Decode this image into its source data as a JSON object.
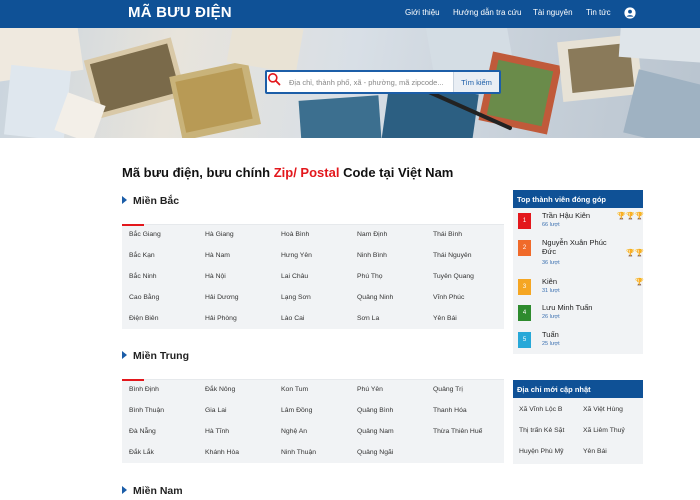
{
  "header": {
    "logo": "MÃ BƯU ĐIỆN",
    "nav": [
      "Giới thiệu",
      "Hướng dẫn tra cứu",
      "Tài nguyên",
      "Tin tức"
    ]
  },
  "search": {
    "placeholder": "Địa chỉ, thành phố, xã - phường, mã zipcode...",
    "button": "Tìm kiếm"
  },
  "title": {
    "part1": "Mã bưu điện, bưu chính ",
    "highlight": "Zip/ Postal",
    "part2": " Code tại Việt Nam"
  },
  "regions": [
    {
      "name": "Miền Bắc",
      "provinces": [
        "Bắc Giang",
        "Hà Giang",
        "Hoà Bình",
        "Nam Định",
        "Thái Bình",
        "Bắc Kạn",
        "Hà Nam",
        "Hưng Yên",
        "Ninh Bình",
        "Thái Nguyên",
        "Bắc Ninh",
        "Hà Nội",
        "Lai Châu",
        "Phú Thọ",
        "Tuyên Quang",
        "Cao Bằng",
        "Hải Dương",
        "Lạng Sơn",
        "Quảng Ninh",
        "Vĩnh Phúc",
        "Điện Biên",
        "Hải Phòng",
        "Lào Cai",
        "Sơn La",
        "Yên Bái"
      ]
    },
    {
      "name": "Miền Trung",
      "provinces": [
        "Bình Định",
        "Đắk Nông",
        "Kon Tum",
        "Phú Yên",
        "Quảng Trị",
        "Bình Thuận",
        "Gia Lai",
        "Lâm Đồng",
        "Quảng Bình",
        "Thanh Hóa",
        "Đà Nẵng",
        "Hà Tĩnh",
        "Nghệ An",
        "Quảng Nam",
        "Thừa Thiên Huế",
        "Đắk Lắk",
        "Khánh Hòa",
        "Ninh Thuận",
        "Quảng Ngãi"
      ]
    },
    {
      "name": "Miền Nam",
      "provinces": []
    }
  ],
  "top_members": {
    "title": "Top thành viên đóng góp",
    "members": [
      {
        "rank": "1",
        "name": "Trần Hậu Kiên",
        "count": "66 lượt",
        "color": "#e3171c",
        "trophies": 3
      },
      {
        "rank": "2",
        "name": "Nguyễn Xuân Phúc Đức",
        "count": "36 lượt",
        "color": "#f06a2a",
        "trophies": 2
      },
      {
        "rank": "3",
        "name": "Kiên",
        "count": "31 lượt",
        "color": "#f5a623",
        "trophies": 1
      },
      {
        "rank": "4",
        "name": "Lưu Minh Tuấn",
        "count": "26 lượt",
        "color": "#2e8b2e",
        "trophies": 0
      },
      {
        "rank": "5",
        "name": "Tuấn",
        "count": "25 lượt",
        "color": "#27a8d8",
        "trophies": 0
      }
    ]
  },
  "recent_updates": {
    "title": "Địa chỉ mới cập nhật",
    "items": [
      "Xã Vĩnh Lộc B",
      "Xã Việt Hùng",
      "Thị trấn Kẻ Sặt",
      "Xã Liêm Thuỷ",
      "Huyện Phù Mỹ",
      "Yên Bái"
    ]
  },
  "colors": {
    "header_blue": "#0f5196",
    "accent_red": "#e3171c",
    "link_blue": "#3a6fb0"
  }
}
